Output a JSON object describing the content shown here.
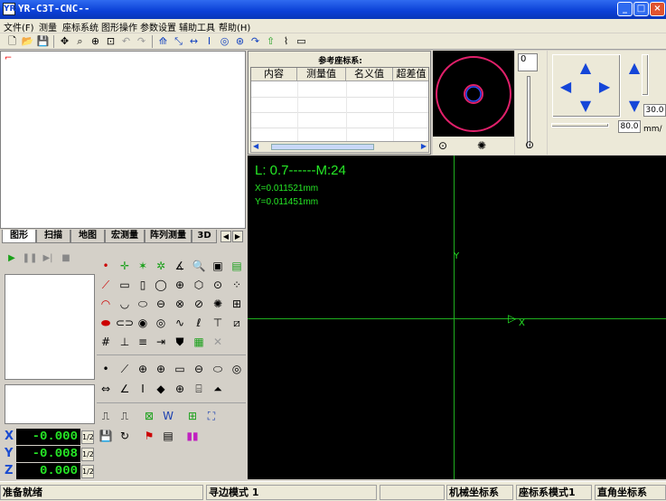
{
  "window": {
    "title": "YR-C3T-CNC--",
    "app_icon": "YR",
    "min": "_",
    "max": "□",
    "close": "×"
  },
  "menu": [
    "文件(F)",
    "测量",
    "座标系统",
    "图形操作",
    "参数设置",
    "辅助工具",
    "帮助(H)"
  ],
  "toolbar": {
    "icons": [
      "new-file-icon",
      "open-folder-icon",
      "save-icon",
      "pan-icon",
      "zoom-window-icon",
      "zoom-all-icon",
      "zoom-extents-icon",
      "undo-icon",
      "redo-icon",
      "probe-icon",
      "probe-tool-icon",
      "distance-icon",
      "height-icon",
      "angle-icon",
      "rotate-icon",
      "arc-icon",
      "home-icon",
      "curve-icon",
      "window-icon"
    ]
  },
  "tabs": [
    "图形",
    "扫描",
    "地图",
    "宏测量",
    "阵列测量",
    "3D"
  ],
  "reference": {
    "title": "参考座标系:",
    "columns": [
      "内容",
      "测量值",
      "名义值",
      "超差值"
    ]
  },
  "light": {
    "value": "0"
  },
  "jog": {
    "step_value": "30.0",
    "speed_value": "80.0",
    "unit": "mm/"
  },
  "measurement": {
    "lm": "L: 0.7------M:24",
    "x_readout": "X=0.011521mm",
    "y_readout": "Y=0.011451mm",
    "axis_y": "Y",
    "axis_x": "X"
  },
  "coords": [
    {
      "axis": "X",
      "value": "-0.000",
      "frac": "1/2"
    },
    {
      "axis": "Y",
      "value": "-0.008",
      "frac": "1/2"
    },
    {
      "axis": "Z",
      "value": "0.000",
      "frac": "1/2"
    }
  ],
  "statusbar": [
    "准备就绪",
    "寻边模式 1",
    "机械坐标系",
    "座标系模式1",
    "直角坐标系"
  ],
  "colors": {
    "title_blue": "#0a3fd6",
    "display_bg": "#000000",
    "readout_green": "#26e826",
    "jog_blue": "#1546d8"
  }
}
